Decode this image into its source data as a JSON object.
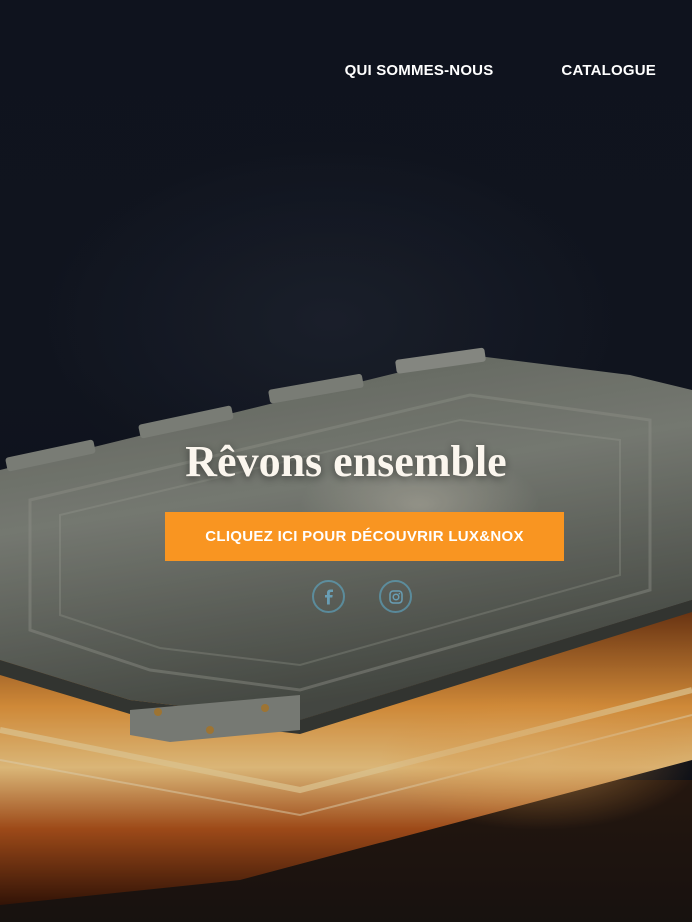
{
  "nav": {
    "items": [
      {
        "label": "QUI SOMMES-NOUS"
      },
      {
        "label": "CATALOGUE"
      }
    ]
  },
  "hero": {
    "headline": "Rêvons ensemble",
    "cta_label": "CLIQUEZ ICI POUR DÉCOUVRIR LUX&NOX"
  },
  "social": {
    "icons": [
      "facebook-icon",
      "instagram-icon"
    ]
  },
  "colors": {
    "accent": "#f99521",
    "background": "#0f131b",
    "social_icon": "#5cb2d6"
  }
}
